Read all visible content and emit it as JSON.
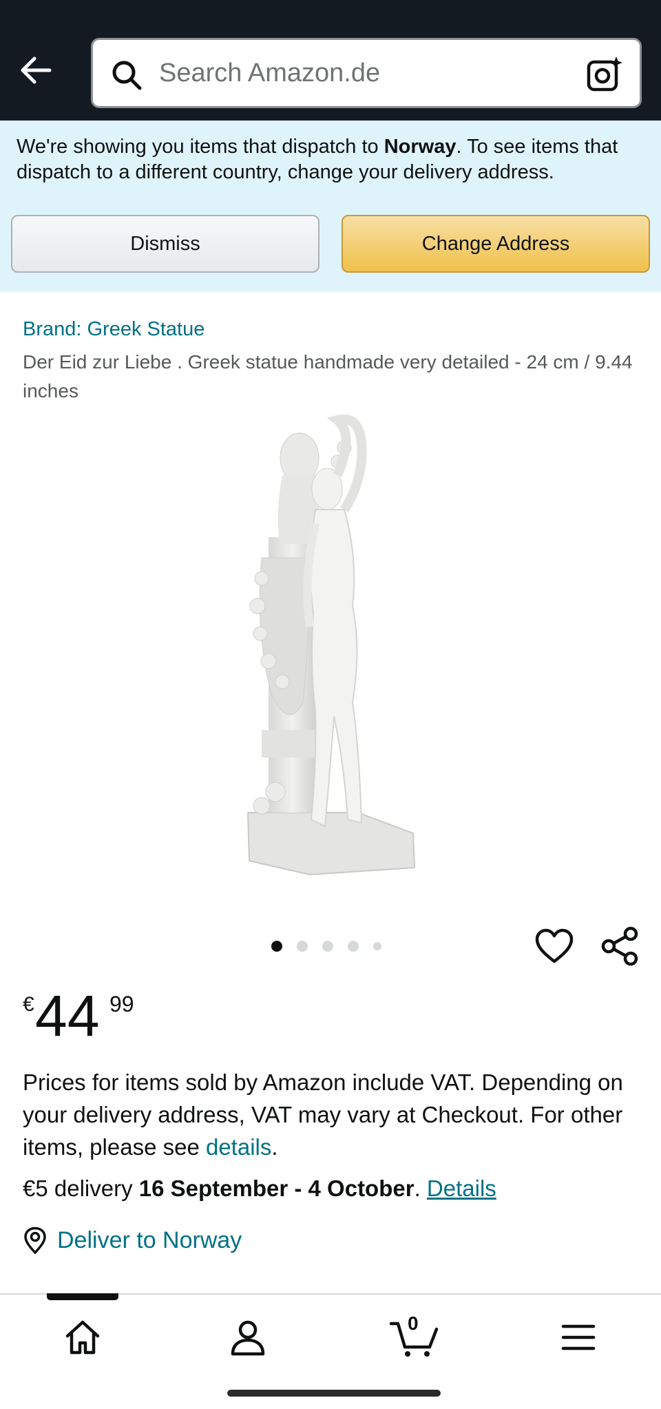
{
  "header": {
    "search_placeholder": "Search Amazon.de"
  },
  "banner": {
    "text_prefix": "We're showing you items that dispatch to ",
    "country": "Norway",
    "text_suffix": ". To see items that dispatch to a different country, change your delivery address.",
    "dismiss_label": "Dismiss",
    "change_address_label": "Change Address"
  },
  "product": {
    "brand": "Brand: Greek Statue",
    "title": "Der Eid zur Liebe . Greek statue handmade very detailed - 24 cm / 9.44 inches",
    "image_count": 5,
    "active_image": 1,
    "price": {
      "currency": "€",
      "whole": "44",
      "fraction": "99"
    },
    "vat_text": "Prices for items sold by Amazon include VAT. Depending on your delivery address, VAT may vary at Checkout. For other items, please see ",
    "vat_link": "details",
    "vat_end": ".",
    "delivery_prefix": "€5 delivery ",
    "delivery_dates": "16 September - 4 October",
    "delivery_period": ". ",
    "delivery_link": "Details",
    "deliver_to": "Deliver to Norway"
  },
  "bottom_nav": {
    "cart_count": "0"
  },
  "colors": {
    "header_bg": "#131a22",
    "banner_bg": "#dff3fb",
    "link": "#007185",
    "change_button": "#f0c14b"
  }
}
